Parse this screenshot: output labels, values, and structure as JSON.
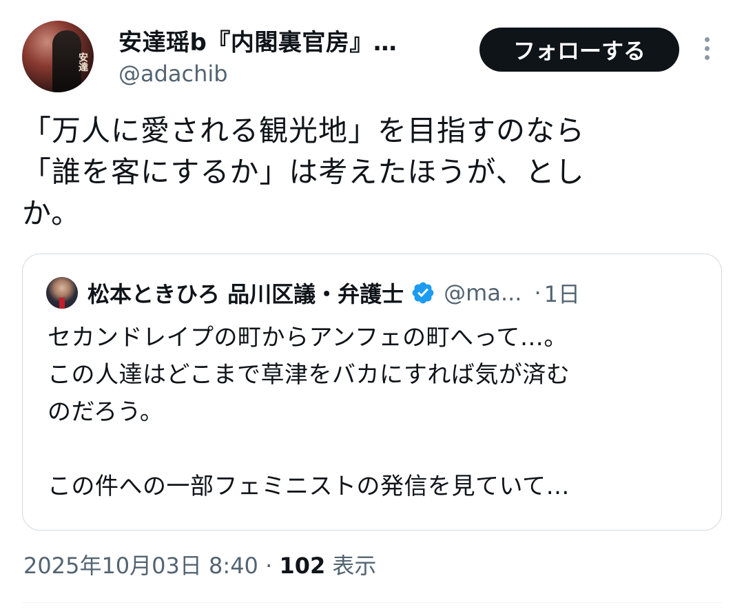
{
  "author": {
    "display_name": "安達瑶b『内閣裏官房』…",
    "handle": "@adachib",
    "avatar_text": "安達"
  },
  "follow_button": {
    "label": "フォローする"
  },
  "more_icon": "more-dots-vertical-icon",
  "tweet": {
    "lines": [
      "「万人に愛される観光地」を目指すのなら",
      "「誰を客にするか」は考えたほうが、とし",
      "か。"
    ]
  },
  "quote": {
    "display_name": "松本ときひろ 品川区議・弁護士",
    "handle": "@ma...",
    "separator": "·",
    "time": "1日",
    "verified_color": "#1d9bf0",
    "lines": [
      "セカンドレイプの町からアンフェの町へって…。",
      "この人達はどこまで草津をバカにすれば気が済む",
      "のだろう。",
      "",
      "この件への一部フェミニストの発信を見ていて…"
    ]
  },
  "meta": {
    "timestamp": "2025年10月03日 8:40",
    "separator": "·",
    "views_count": "102",
    "views_label": "表示"
  }
}
